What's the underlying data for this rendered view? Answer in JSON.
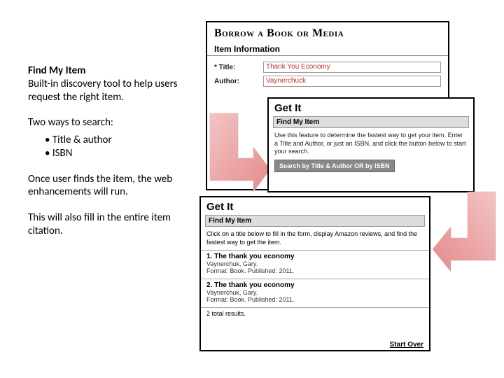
{
  "left": {
    "heading": "Find My Item",
    "p1": "Built-in discovery tool to help users request the right item.",
    "p2": "Two ways to search:",
    "bullets": [
      "Title & author",
      "ISBN"
    ],
    "p3": "Once user finds the item, the web enhancements will run.",
    "p4": "This will also fill in the entire item citation."
  },
  "borrow": {
    "title": "Borrow a Book or Media",
    "subtitle": "Item Information",
    "row_title_label": "* Title:",
    "row_title_value": "Thank You Economy",
    "row_author_label": "Author:",
    "row_author_value": "Vaynerchuck"
  },
  "getit1": {
    "title": "Get It",
    "bar": "Find My Item",
    "desc": "Use this feature to determine the fastest way to get your item. Enter a Title and Author, or just an ISBN, and click the button below to start your search.",
    "button": "Search by Title & Author OR by ISBN"
  },
  "getit2": {
    "title": "Get It",
    "bar": "Find My Item",
    "desc": "Click on a title below to fill in the form, display Amazon reviews, and find the fastest way to get the item.",
    "results": [
      {
        "title": "1. The thank you economy",
        "author": "Vaynerchuk, Gary.",
        "meta": "Format: Book. Published: 2011."
      },
      {
        "title": "2. The thank you economy",
        "author": "Vaynerchuk, Gary.",
        "meta": "Format: Book. Published: 2011."
      }
    ],
    "totals": "2 total results.",
    "startover": "Start Over"
  }
}
